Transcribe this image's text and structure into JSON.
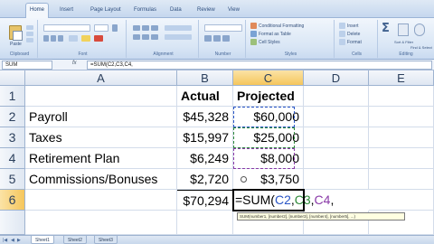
{
  "ribbon": {
    "tabs": [
      "Home",
      "Insert",
      "Page Layout",
      "Formulas",
      "Data",
      "Review",
      "View"
    ],
    "groups": [
      "Clipboard",
      "Font",
      "Alignment",
      "Number",
      "Styles",
      "Cells",
      "Editing"
    ],
    "styles_items": [
      "Conditional Formatting",
      "Format as Table",
      "Cell Styles"
    ],
    "cells_items": [
      "Insert",
      "Delete",
      "Format"
    ],
    "editing_items": [
      "Sort & Filter",
      "Find & Select"
    ],
    "paste_label": "Paste"
  },
  "formula_bar": {
    "name_box": "SUM",
    "fx": "fx",
    "formula": "=SUM(C2,C3,C4,"
  },
  "columns": [
    "A",
    "B",
    "C",
    "D",
    "E"
  ],
  "rows": [
    "1",
    "2",
    "3",
    "4",
    "5",
    "6"
  ],
  "cells": {
    "B1": "Actual",
    "C1": "Projected",
    "A2": "Payroll",
    "B2": "$45,328",
    "C2": "$60,000",
    "A3": "Taxes",
    "B3": "$15,997",
    "C3": "$25,000",
    "A4": "Retirement Plan",
    "B4": "$6,249",
    "C4": "$8,000",
    "A5": "Commissions/Bonuses",
    "B5": "$2,720",
    "C5": "$3,750",
    "B6": "$70,294"
  },
  "editing_formula": {
    "prefix": "=SUM(",
    "ref1": "C2",
    "sep1": ",",
    "ref2": "C3",
    "sep2": ",",
    "ref3": "C4",
    "sep3": ","
  },
  "tooltip": "SUM(number1, [number2], [number3], [number4], [number5], ...)",
  "sheets": [
    "Sheet1",
    "Sheet2",
    "Sheet3"
  ],
  "colors": {
    "ref1": "#2a56c6",
    "ref2": "#2f8a3a",
    "ref3": "#8a3aa8",
    "selected_header": "#f5c65c"
  }
}
